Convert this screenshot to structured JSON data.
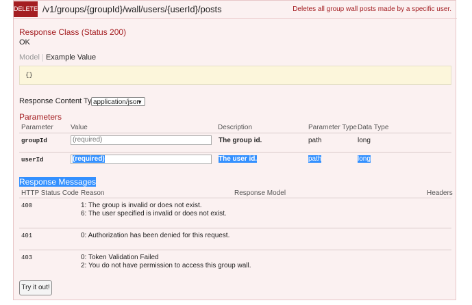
{
  "header": {
    "method": "DELETE",
    "path": "/v1/groups/{groupId}/wall/users/{userId}/posts",
    "summary": "Deletes all group wall posts made by a specific user."
  },
  "response_class": {
    "title": "Response Class (Status 200)",
    "status": "OK",
    "tab_model": "Model",
    "tab_example": "Example Value",
    "example": "{}"
  },
  "content_type": {
    "label": "Response Content Type",
    "selected": "application/json"
  },
  "parameters": {
    "title": "Parameters",
    "columns": [
      "Parameter",
      "Value",
      "Description",
      "Parameter Type",
      "Data Type"
    ],
    "rows": [
      {
        "name": "groupId",
        "placeholder": "(required)",
        "description": "The group id.",
        "param_type": "path",
        "data_type": "long"
      },
      {
        "name": "userId",
        "placeholder": "(required)",
        "description": "The user id.",
        "param_type": "path",
        "data_type": "long"
      }
    ]
  },
  "response_messages": {
    "title": "Response Messages",
    "columns": [
      "HTTP Status Code",
      "Reason",
      "Response Model",
      "Headers"
    ],
    "rows": [
      {
        "code": "400",
        "reasons": [
          "1: The group is invalid or does not exist.",
          "6: The user specified is invalid or does not exist."
        ]
      },
      {
        "code": "401",
        "reasons": [
          "0: Authorization has been denied for this request."
        ]
      },
      {
        "code": "403",
        "reasons": [
          "0: Token Validation Failed",
          "2: You do not have permission to access this group wall."
        ]
      }
    ]
  },
  "try_button": "Try it out!",
  "colors": {
    "accent": "#a41e22",
    "panel_bg": "#fbf1f1",
    "selection": "#3390ff"
  }
}
